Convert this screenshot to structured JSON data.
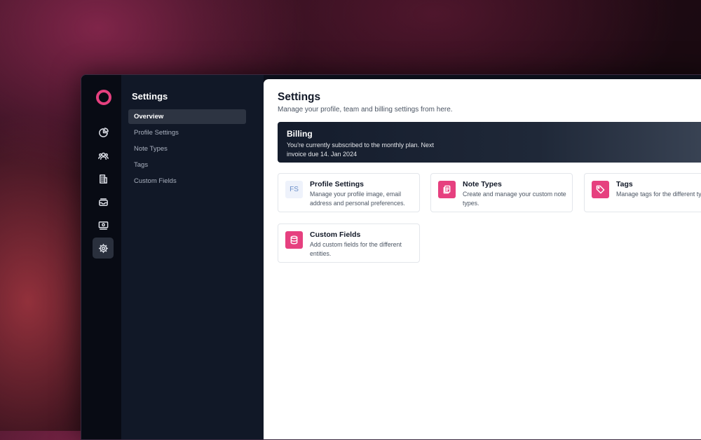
{
  "sidebar": {
    "title": "Settings",
    "items": [
      {
        "label": "Overview",
        "active": true
      },
      {
        "label": "Profile Settings"
      },
      {
        "label": "Note Types"
      },
      {
        "label": "Tags"
      },
      {
        "label": "Custom Fields"
      }
    ]
  },
  "rail": {
    "icons": [
      "pie-chart-icon",
      "users-icon",
      "building-icon",
      "inbox-icon",
      "banknote-icon",
      "settings-icon"
    ],
    "active": "settings-icon"
  },
  "main": {
    "title": "Settings",
    "subtitle": "Manage your profile, team and billing settings from here.",
    "billing": {
      "title": "Billing",
      "text": "You're currently subscribed to the monthly plan. Next invoice due 14. Jan 2024"
    },
    "cards": [
      {
        "icon_text": "FS",
        "title": "Profile Settings",
        "desc": "Manage your profile image, email address and personal preferences."
      },
      {
        "icon": "notes-icon",
        "title": "Note Types",
        "desc": "Create and manage your custom note types."
      },
      {
        "icon": "tag-icon",
        "title": "Tags",
        "desc": "Manage tags for the different types."
      },
      {
        "icon": "database-icon",
        "title": "Custom Fields",
        "desc": "Add custom fields for the different entities."
      }
    ]
  },
  "colors": {
    "accent": "#e6407f",
    "sidebar_bg": "#111827",
    "rail_bg": "#080b14"
  }
}
